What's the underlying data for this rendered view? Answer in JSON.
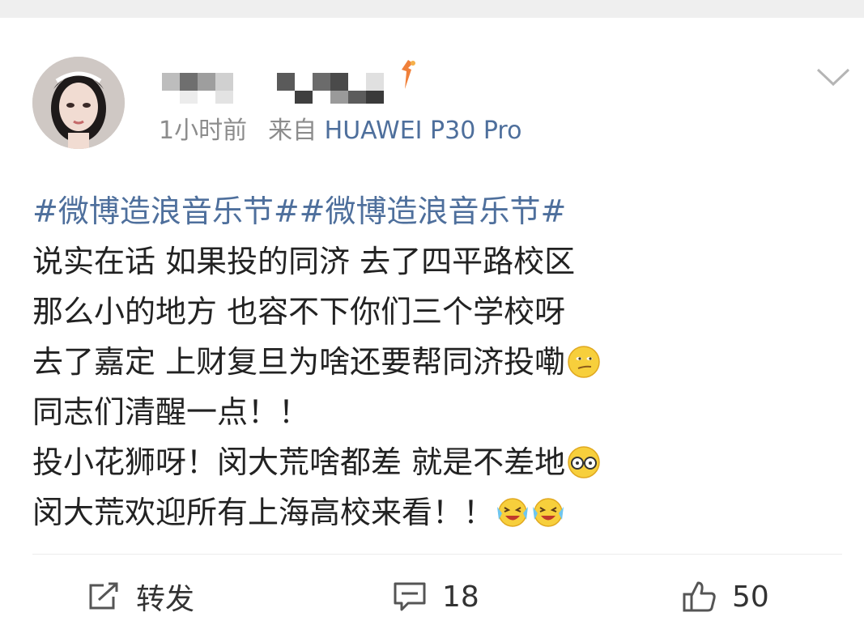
{
  "post": {
    "author": {
      "display_name_obscured": true,
      "avatar": "profile-photo"
    },
    "time": "1小时前",
    "source_prefix": "来自",
    "device": "HUAWEI P30 Pro",
    "content": {
      "hashtags": "#微博造浪音乐节##微博造浪音乐节#",
      "lines": [
        "说实在话 如果投的同济 去了四平路校区",
        "那么小的地方 也容不下你们三个学校呀",
        "去了嘉定 上财复旦为啥还要帮同济投嘞",
        "同志们清醒一点！！",
        "投小花狮呀！闵大荒啥都差 就是不差地",
        "闵大荒欢迎所有上海高校来看！！"
      ]
    }
  },
  "actions": {
    "repost_label": "转发",
    "comment_count": "18",
    "like_count": "50"
  },
  "colors": {
    "link": "#4e6f9c",
    "meta": "#8c8c8c",
    "text": "#222222",
    "vip_orange": "#f0803a"
  },
  "icons": {
    "chevron": "chevron-down-icon",
    "repost": "repost-icon",
    "comment": "comment-icon",
    "like": "thumbs-up-icon",
    "emoji_1": "smirk-emoji",
    "emoji_2": "glasses-emoji",
    "emoji_3": "laughing-tears-emoji"
  }
}
